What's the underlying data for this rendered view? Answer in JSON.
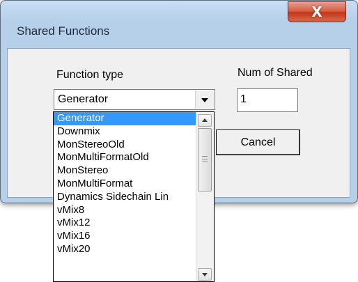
{
  "window": {
    "title": "Shared Functions",
    "close_glyph": "X"
  },
  "form": {
    "function_type_label": "Function type",
    "num_shared_label": "Num of Shared",
    "function_type_value": "Generator",
    "num_shared_value": "1",
    "cancel_label": "Cancel"
  },
  "dropdown": {
    "items": [
      "Generator",
      "Downmix",
      "MonStereoOld",
      "MonMultiFormatOld",
      "MonStereo",
      "MonMultiFormat",
      "Dynamics Sidechain Lin",
      "vMix8",
      "vMix12",
      "vMix16",
      "vMix20"
    ],
    "selected_index": 0
  },
  "icons": {
    "close": "close-icon",
    "dropdown_arrow": "chevron-down-icon",
    "scroll_up": "scroll-up-icon",
    "scroll_down": "scroll-down-icon"
  },
  "colors": {
    "selection": "#3399ff",
    "close_button": "#c23518",
    "titlebar": "#b9d1ea"
  }
}
